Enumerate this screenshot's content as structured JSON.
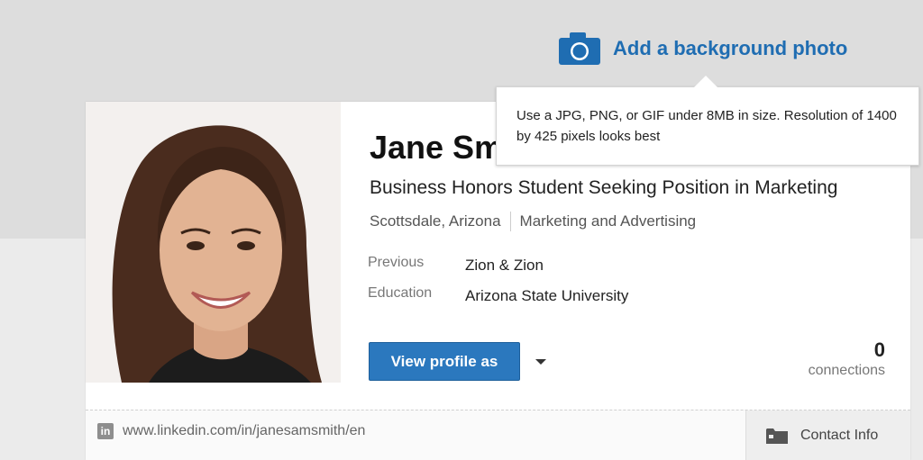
{
  "header": {
    "add_background_label": "Add a background photo"
  },
  "tooltip": {
    "text": "Use a JPG, PNG, or GIF under 8MB in size. Resolution of 1400 by 425 pixels looks best"
  },
  "profile": {
    "name": "Jane Sm",
    "headline": "Business Honors Student Seeking Position in Marketing",
    "location": "Scottsdale, Arizona",
    "industry": "Marketing and Advertising",
    "previous_label": "Previous",
    "previous_value": "Zion & Zion",
    "education_label": "Education",
    "education_value": "Arizona State University",
    "view_profile_label": "View profile as",
    "connections_count": "0",
    "connections_label": "connections",
    "profile_url": "www.linkedin.com/in/janesamsmith/en",
    "contact_info_label": "Contact Info"
  },
  "icons": {
    "camera": "camera-icon",
    "linkedin": "linkedin-icon",
    "folder": "folder-icon",
    "caret": "chevron-down-icon"
  },
  "colors": {
    "accent": "#1f6db2",
    "button": "#2b78be"
  }
}
